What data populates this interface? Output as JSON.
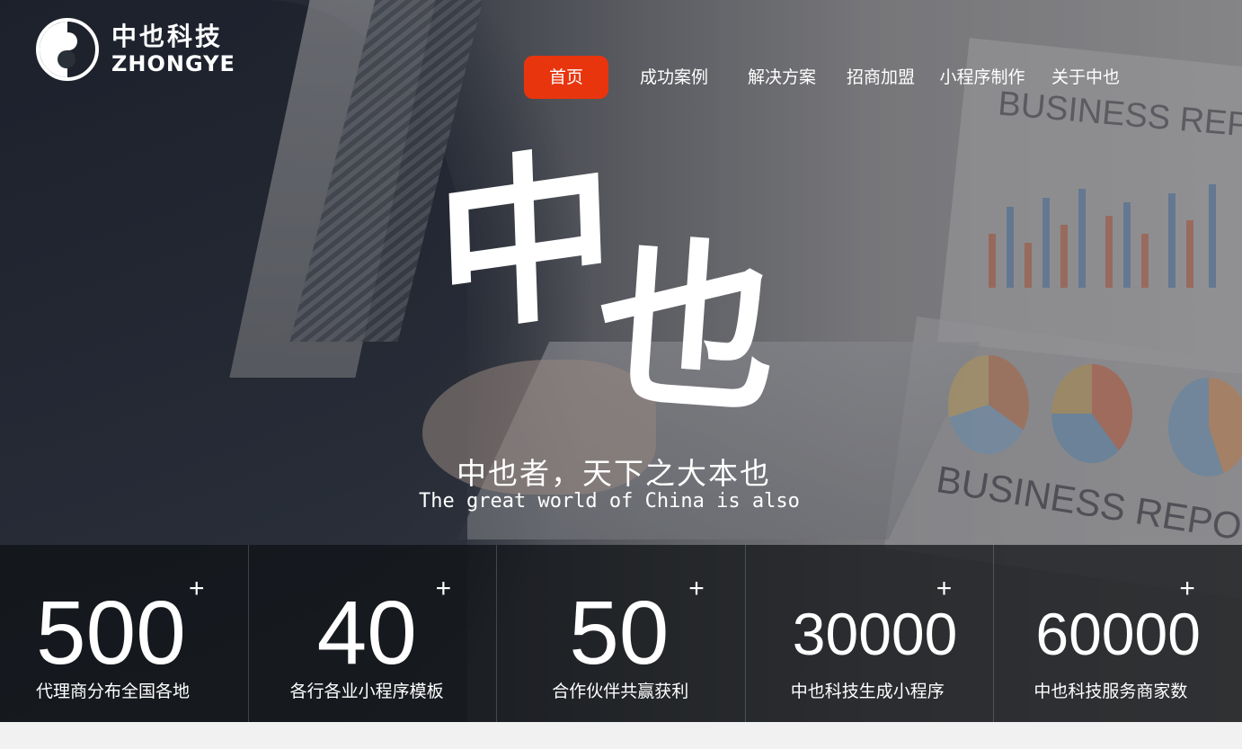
{
  "brand": {
    "name_cn": "中也科技",
    "name_en": "ZHONGYE"
  },
  "nav": [
    {
      "label": "首页",
      "active": true
    },
    {
      "label": "成功案例",
      "active": false
    },
    {
      "label": "解决方案",
      "active": false
    },
    {
      "label": "招商加盟",
      "active": false
    },
    {
      "label": "小程序制作",
      "active": false
    },
    {
      "label": "关于中也",
      "active": false
    }
  ],
  "hero": {
    "calligraphy": [
      "中",
      "也"
    ],
    "slogan_cn": "中也者，天下之大本也",
    "slogan_en": "The great world of China is also",
    "background_text": [
      "BUSINESS REPORT",
      "BUSINESS REPORT"
    ]
  },
  "stats": [
    {
      "number": "500",
      "plus": "+",
      "label": "代理商分布全国各地"
    },
    {
      "number": "40",
      "plus": "+",
      "label": "各行各业小程序模板"
    },
    {
      "number": "50",
      "plus": "+",
      "label": "合作伙伴共赢获利"
    },
    {
      "number": "30000",
      "plus": "+",
      "label": "中也科技生成小程序"
    },
    {
      "number": "60000",
      "plus": "+",
      "label": "中也科技服务商家数"
    }
  ],
  "colors": {
    "accent": "#e8350e",
    "stat_bg": "#0e1014"
  }
}
